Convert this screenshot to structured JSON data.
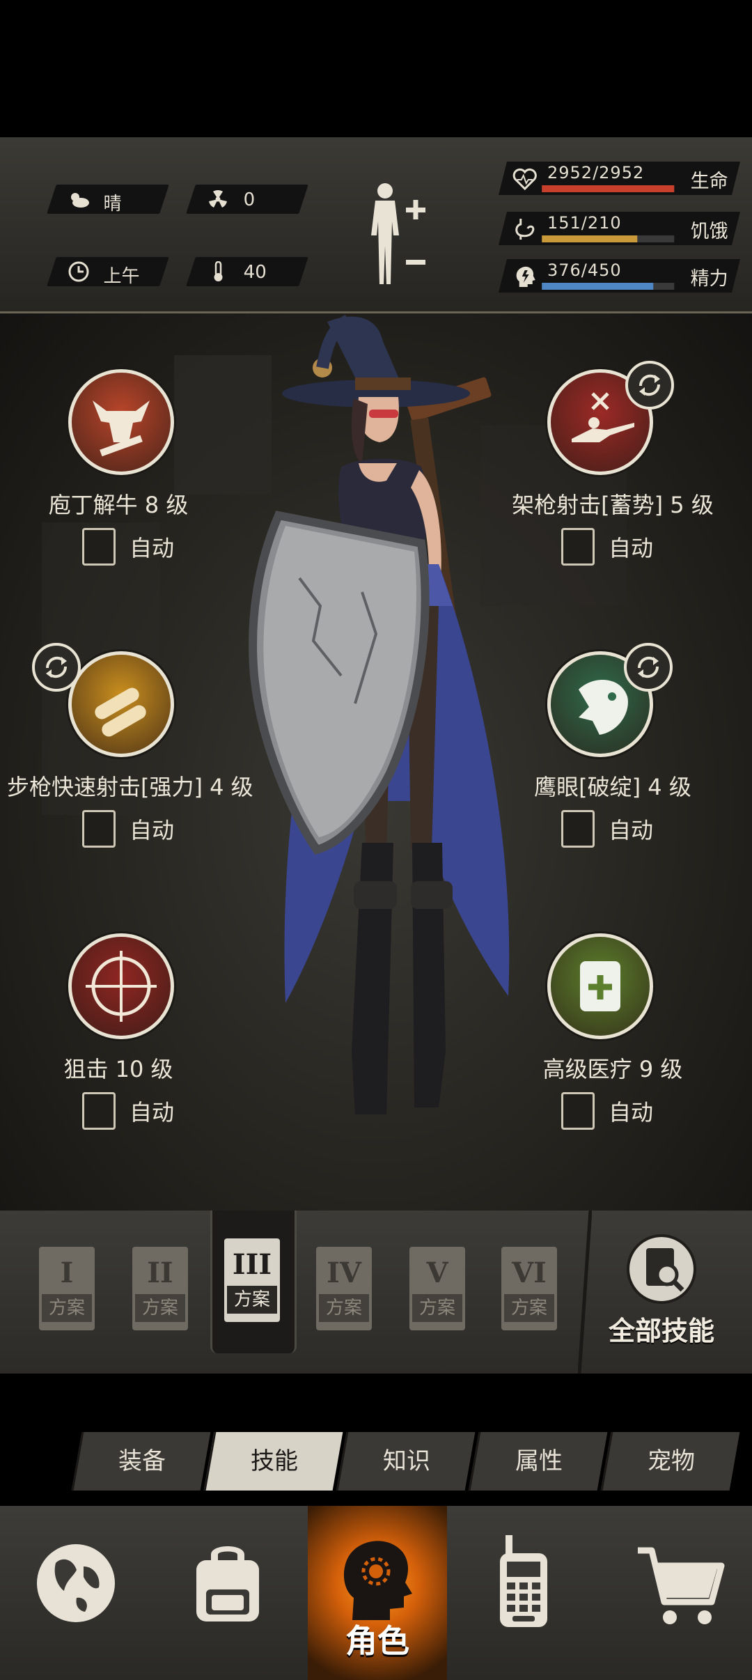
{
  "hud": {
    "weather": "晴",
    "radiation": "0",
    "time_of_day": "上午",
    "temperature": "40",
    "stats": [
      {
        "icon": "heart-icon",
        "value": "2952/2952",
        "label": "生命",
        "fill": 1.0,
        "color": "#c8402c"
      },
      {
        "icon": "stomach-icon",
        "value": "151/210",
        "label": "饥饿",
        "fill": 0.72,
        "color": "#c99a3a"
      },
      {
        "icon": "energy-head-icon",
        "value": "376/450",
        "label": "精力",
        "fill": 0.84,
        "color": "#4f87c4"
      }
    ]
  },
  "skills": [
    {
      "name": "庖丁解牛 8 级",
      "auto": "自动",
      "icon": "bull-skull-icon",
      "color": "#b8452a",
      "swap": false
    },
    {
      "name": "架枪射击[蓄势] 5 级",
      "auto": "自动",
      "icon": "prone-sniper-icon",
      "color": "#9c2a26",
      "swap": true
    },
    {
      "name": "步枪快速射击[强力] 4 级",
      "auto": "自动",
      "icon": "bullets-icon",
      "color": "#c98e1e",
      "swap": true
    },
    {
      "name": "鹰眼[破绽] 4 级",
      "auto": "自动",
      "icon": "eagle-icon",
      "color": "#2f6a4b",
      "swap": true
    },
    {
      "name": "狙击 10 级",
      "auto": "自动",
      "icon": "crosshair-icon",
      "color": "#8f2622",
      "swap": false
    },
    {
      "name": "高级医疗 9 级",
      "auto": "自动",
      "icon": "medical-kit-icon",
      "color": "#5b7f2c",
      "swap": false
    }
  ],
  "plans": [
    {
      "roman": "I",
      "label": "方案",
      "selected": false
    },
    {
      "roman": "II",
      "label": "方案",
      "selected": false
    },
    {
      "roman": "III",
      "label": "方案",
      "selected": true
    },
    {
      "roman": "IV",
      "label": "方案",
      "selected": false
    },
    {
      "roman": "V",
      "label": "方案",
      "selected": false
    },
    {
      "roman": "VI",
      "label": "方案",
      "selected": false
    }
  ],
  "all_skills_label": "全部技能",
  "tabs": [
    "装备",
    "技能",
    "知识",
    "属性",
    "宠物"
  ],
  "active_tab": "技能",
  "nav": {
    "items": [
      "globe-icon",
      "backpack-icon",
      "character-icon",
      "radio-icon",
      "cart-icon"
    ],
    "active_label": "角色"
  }
}
